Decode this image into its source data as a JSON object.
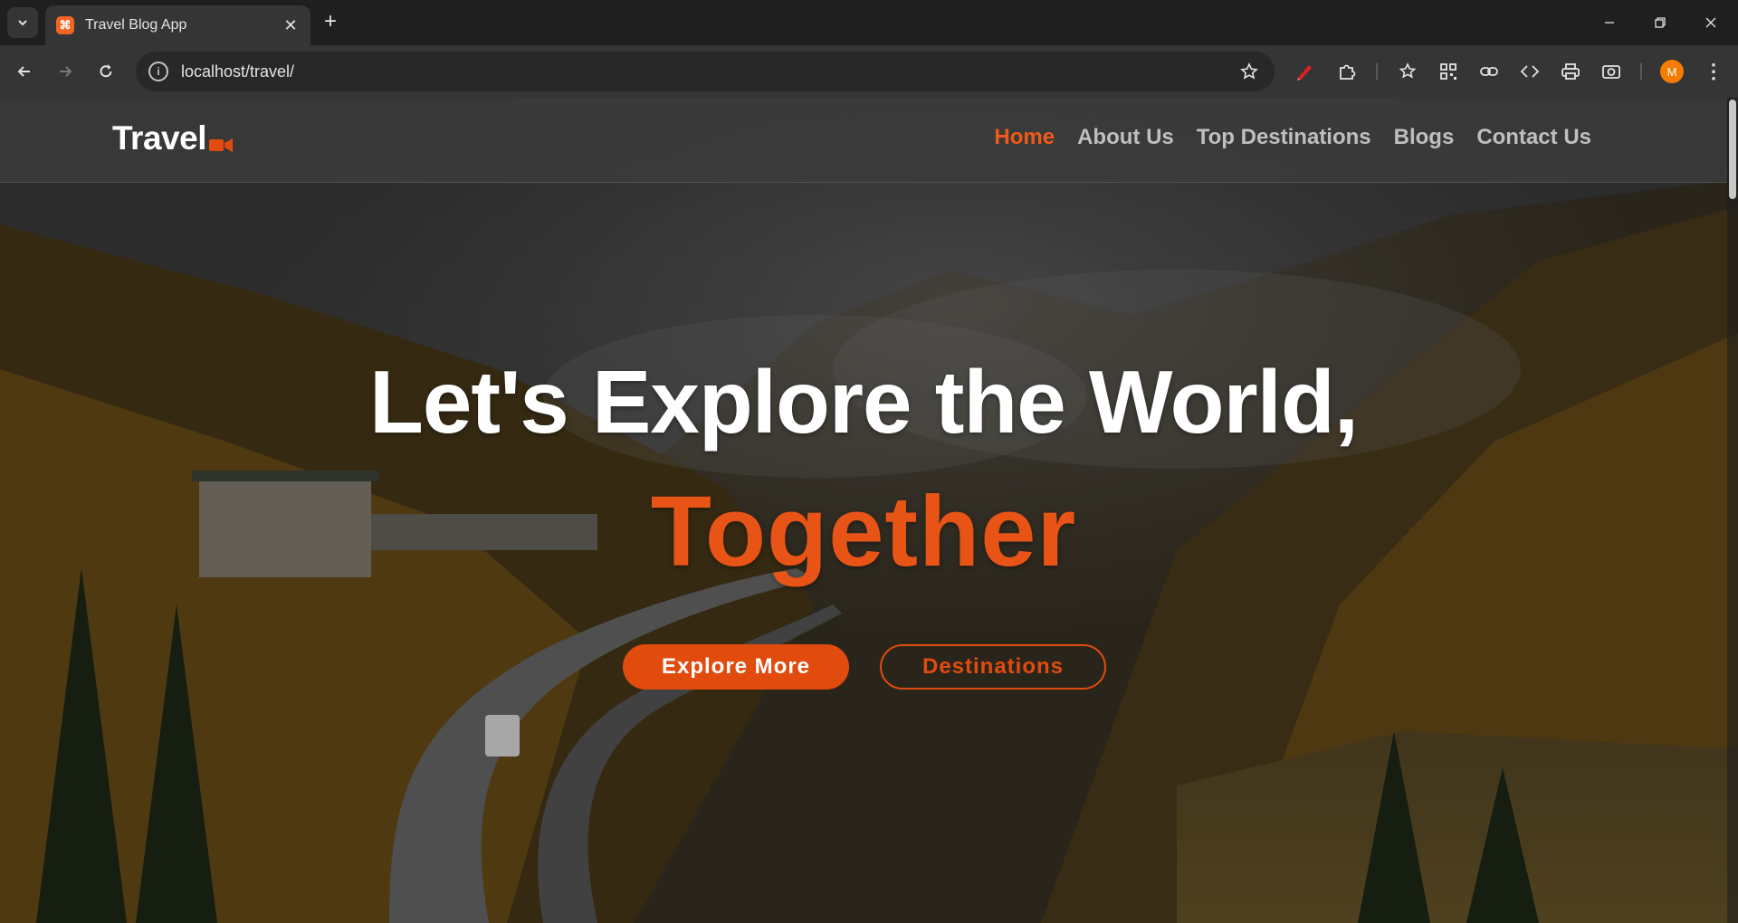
{
  "browser": {
    "tab_title": "Travel Blog App",
    "url": "localhost/travel/",
    "profile_initial": "M",
    "favicon_glyph": "⌘"
  },
  "site": {
    "brand": "Travel",
    "nav": [
      {
        "label": "Home",
        "active": true
      },
      {
        "label": "About Us",
        "active": false
      },
      {
        "label": "Top Destinations",
        "active": false
      },
      {
        "label": "Blogs",
        "active": false
      },
      {
        "label": "Contact Us",
        "active": false
      }
    ]
  },
  "hero": {
    "headline": "Let's Explore the World,",
    "accent": "Together",
    "primary_button": "Explore More",
    "secondary_button": "Destinations"
  },
  "colors": {
    "accent": "#e14b0e",
    "nav_active": "#ef5a18",
    "chrome_dark": "#1f1f1f",
    "chrome_toolbar": "#353535"
  }
}
